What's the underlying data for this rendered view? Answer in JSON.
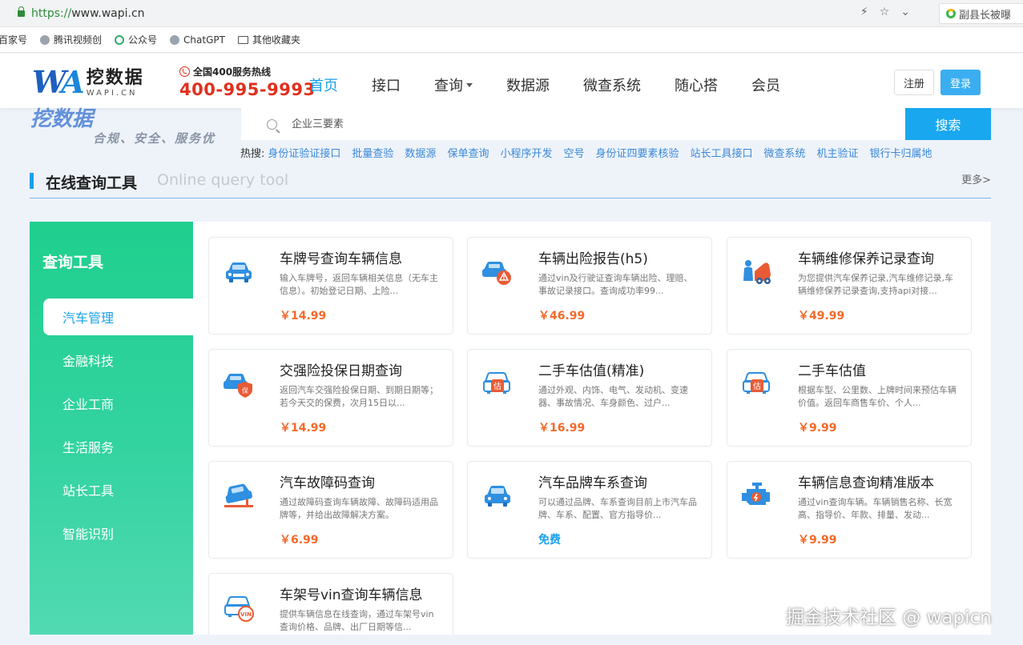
{
  "browser": {
    "url_protocol": "https://",
    "url_host": "www.wapi.cn",
    "extension_text": "副县长被曝",
    "bookmarks": [
      "百家号",
      "腾讯视频创",
      "公众号",
      "ChatGPT",
      "其他收藏夹"
    ]
  },
  "header": {
    "logo_mark": "WA",
    "logo_name": "挖数据",
    "logo_sub": "WAPI.CN",
    "hotline_label": "全国400服务热线",
    "hotline_number": "400-995-9993",
    "nav": [
      "首页",
      "接口",
      "查询",
      "数据源",
      "微查系统",
      "随心搭",
      "会员"
    ],
    "register_label": "注册",
    "login_label": "登录"
  },
  "banner": {
    "logo_text": "挖数据",
    "slogan": "合规、安全、服务优",
    "search_placeholder": "企业三要素",
    "search_button": "搜索",
    "hot_label": "热搜:",
    "hot_items": [
      "身份证验证接口",
      "批量查验",
      "数据源",
      "保单查询",
      "小程序开发",
      "空号",
      "身份证四要素核验",
      "站长工具接口",
      "微查系统",
      "机主验证",
      "银行卡归属地"
    ]
  },
  "section": {
    "title": "在线查询工具",
    "subtitle": "Online query tool",
    "more": "更多>"
  },
  "sidebar": {
    "title": "查询工具",
    "items": [
      "汽车管理",
      "金融科技",
      "企业工商",
      "生活服务",
      "站长工具",
      "智能识别"
    ]
  },
  "cards": [
    {
      "title": "车牌号查询车辆信息",
      "desc": "输入车牌号，返回车辆相关信息（无车主信息）。初始登记日期、上险...",
      "price": "￥14.99",
      "icon": "car-front-icon"
    },
    {
      "title": "车辆出险报告(h5)",
      "desc": "通过vin及行驶证查询车辆出险、理赔、事故记录接口。查询成功率99...",
      "price": "￥46.99",
      "icon": "car-warning-icon"
    },
    {
      "title": "车辆维修保养记录查询",
      "desc": "为您提供汽车保养记录,汽车维修记录,车辆维修保养记录查询,支持api对接...",
      "price": "￥49.99",
      "icon": "car-repair-icon"
    },
    {
      "title": "交强险投保日期查询",
      "desc": "返回汽车交强险投保日期、到期日期等；若今天交的保费，次月15日以...",
      "price": "￥14.99",
      "icon": "car-insurance-icon"
    },
    {
      "title": "二手车估值(精准)",
      "desc": "通过外观、内饰、电气、发动机、变速器、事故情况、车身颜色、过户...",
      "price": "￥16.99",
      "icon": "car-valuation-icon"
    },
    {
      "title": "二手车估值",
      "desc": "根据车型、公里数、上牌时间来预估车辆价值。返回车商售车价、个人...",
      "price": "￥9.99",
      "icon": "car-valuation-icon"
    },
    {
      "title": "汽车故障码查询",
      "desc": "通过故障码查询车辆故障、故障码适用品牌等，并给出故障解决方案。",
      "price": "￥6.99",
      "icon": "car-fault-icon"
    },
    {
      "title": "汽车品牌车系查询",
      "desc": "可以通过品牌、车系查询目前上市汽车品牌、车系、配置、官方指导价...",
      "price": "免费",
      "icon": "car-brand-icon"
    },
    {
      "title": "车辆信息查询精准版本",
      "desc": "通过vin查询车辆。车辆销售名称、长宽高、指导价、年款、排量、发动...",
      "price": "￥9.99",
      "icon": "engine-icon"
    },
    {
      "title": "车架号vin查询车辆信息",
      "desc": "提供车辆信息在线查询，通过车架号vin查询价格、品牌、出厂日期等信...",
      "price": "",
      "icon": "car-vin-icon"
    }
  ],
  "watermark": "掘金技术社区 @ wapicn",
  "colors": {
    "accent": "#1aa0e8",
    "price": "#f26a2a",
    "sidebar_green": "#1fcf8e",
    "hotline_red": "#e0301e"
  }
}
